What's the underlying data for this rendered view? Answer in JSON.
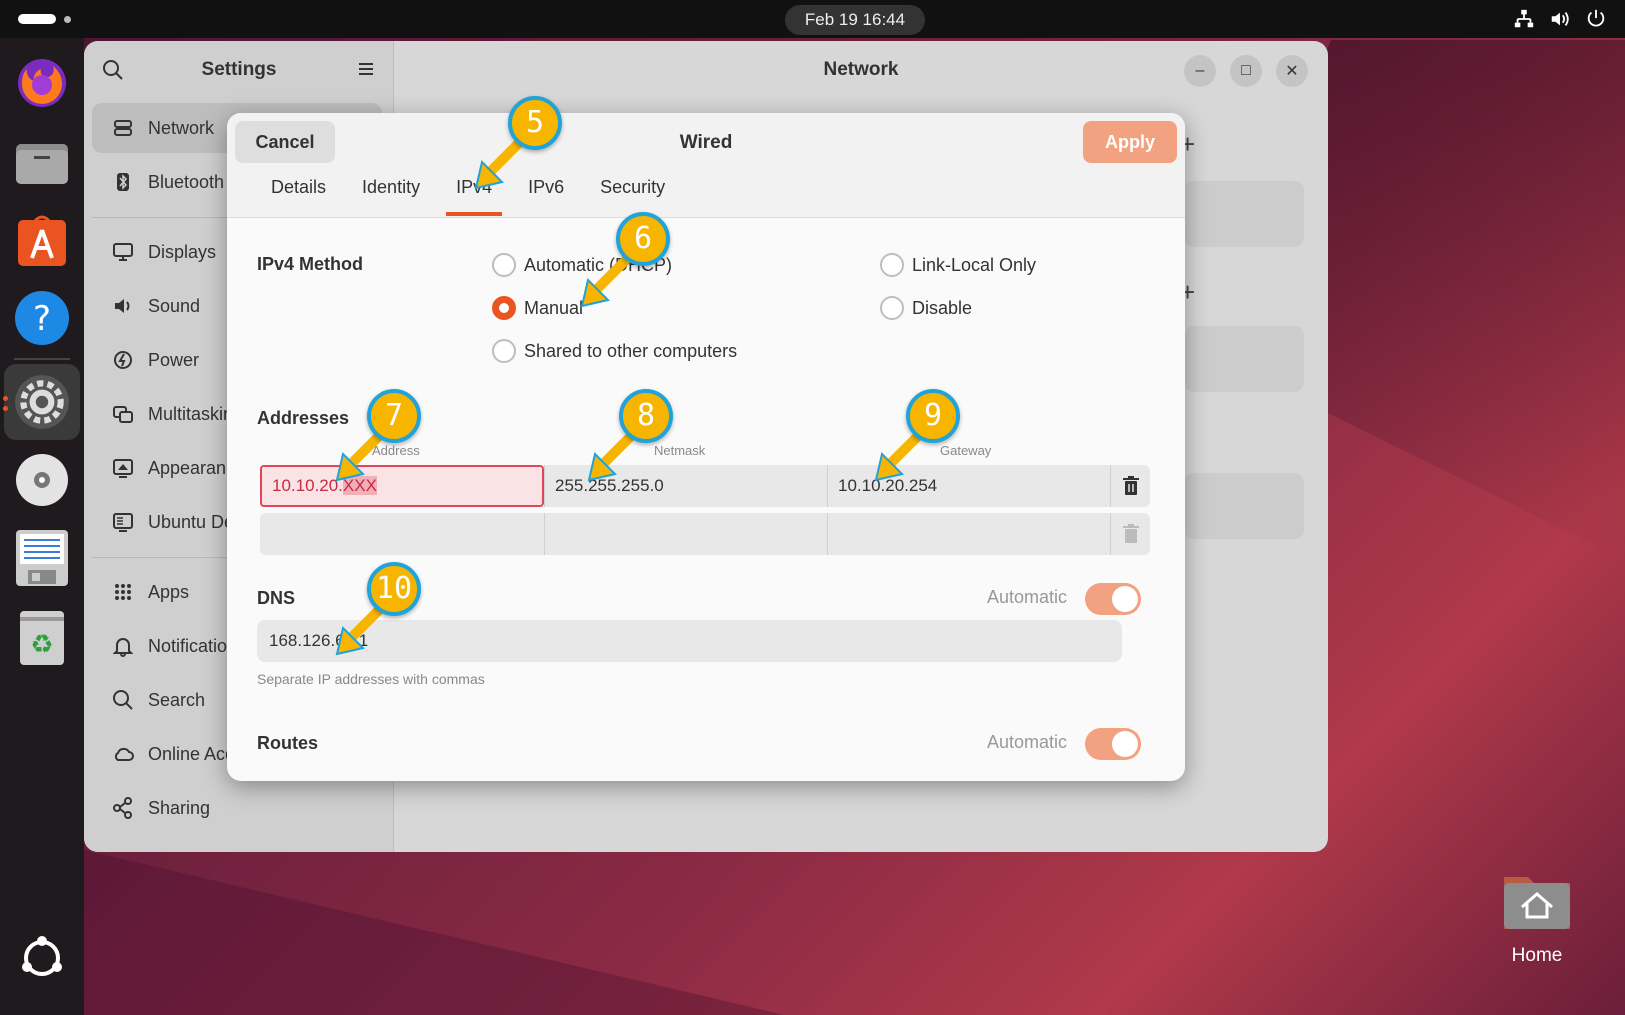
{
  "topbar": {
    "clock": "Feb 19  16:44"
  },
  "settings": {
    "sidebar_title": "Settings",
    "main_title": "Network",
    "sidebar_items": [
      {
        "label": "Network",
        "icon": "network-icon"
      },
      {
        "label": "Bluetooth",
        "icon": "bluetooth-icon"
      },
      {
        "label": "Displays",
        "icon": "display-icon"
      },
      {
        "label": "Sound",
        "icon": "sound-icon"
      },
      {
        "label": "Power",
        "icon": "power-icon"
      },
      {
        "label": "Multitasking",
        "icon": "multitasking-icon"
      },
      {
        "label": "Appearance",
        "icon": "appearance-icon"
      },
      {
        "label": "Ubuntu Desktop",
        "icon": "ubuntu-desktop-icon"
      },
      {
        "label": "Apps",
        "icon": "apps-icon"
      },
      {
        "label": "Notifications",
        "icon": "bell-icon"
      },
      {
        "label": "Search",
        "icon": "search-icon"
      },
      {
        "label": "Online Accounts",
        "icon": "cloud-icon"
      },
      {
        "label": "Sharing",
        "icon": "share-icon"
      }
    ]
  },
  "dialog": {
    "title": "Wired",
    "cancel": "Cancel",
    "apply": "Apply",
    "tabs": [
      "Details",
      "Identity",
      "IPv4",
      "IPv6",
      "Security"
    ],
    "active_tab": "IPv4",
    "ipv4_method_label": "IPv4 Method",
    "methods": {
      "automatic": "Automatic (DHCP)",
      "manual": "Manual",
      "shared": "Shared to other computers",
      "link_local": "Link-Local Only",
      "disable": "Disable"
    },
    "selected_method": "Manual",
    "addresses_label": "Addresses",
    "columns": {
      "address": "Address",
      "netmask": "Netmask",
      "gateway": "Gateway"
    },
    "address_row": {
      "address_prefix": "10.10.20.",
      "address_selected": "XXX",
      "netmask": "255.255.255.0",
      "gateway": "10.10.20.254"
    },
    "dns_label": "DNS",
    "dns_automatic_label": "Automatic",
    "dns_value": "168.126.63.1",
    "dns_hint": "Separate IP addresses with commas",
    "routes_label": "Routes",
    "routes_automatic_label": "Automatic"
  },
  "annotations": [
    "5",
    "6",
    "7",
    "8",
    "9",
    "10"
  ],
  "desktop": {
    "home_label": "Home"
  },
  "colors": {
    "accent": "#e95420",
    "badge": "#f7b500",
    "badge_border": "#1fa3d8",
    "apply_bg": "#f2a280"
  }
}
